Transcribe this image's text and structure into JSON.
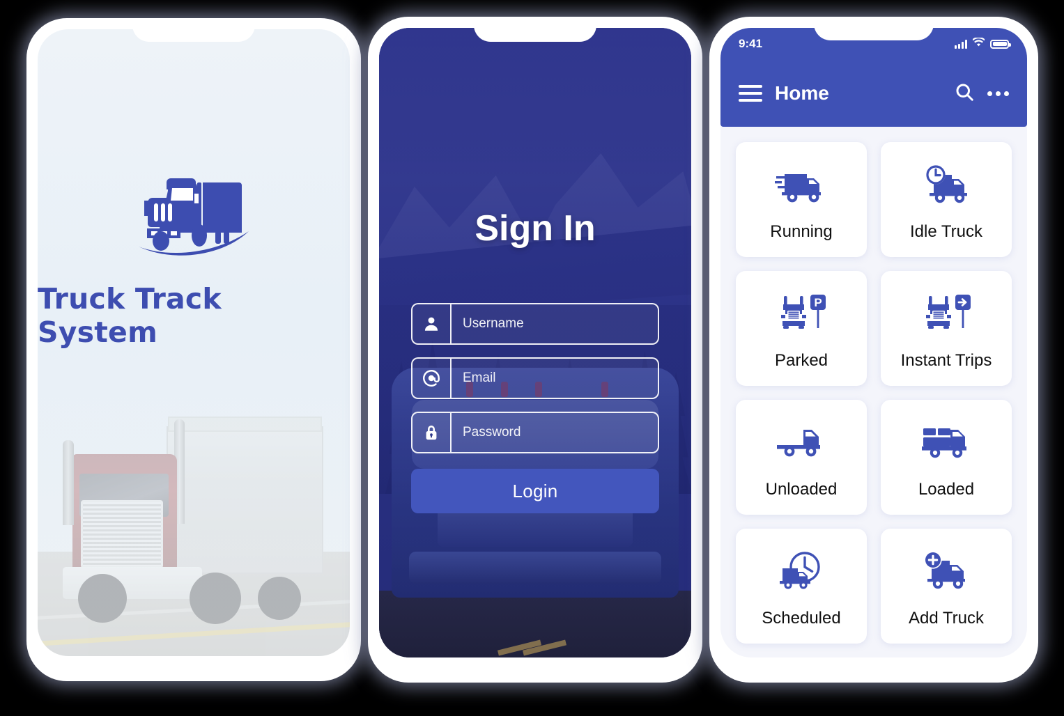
{
  "splash": {
    "app_title": "Truck Track System",
    "logo_icon": "truck-logo-icon",
    "background_photo": "red-semi-truck-on-highway-photo"
  },
  "signin": {
    "title": "Sign In",
    "background_photo": "mountain-forest-highway-truck-photo",
    "fields": [
      {
        "name": "username",
        "icon": "user-icon",
        "placeholder": "Username",
        "value": ""
      },
      {
        "name": "email",
        "icon": "at-sign-icon",
        "placeholder": "Email",
        "value": ""
      },
      {
        "name": "password",
        "icon": "lock-icon",
        "placeholder": "Password",
        "value": ""
      }
    ],
    "login_label": "Login",
    "accent_color": "#4356bd"
  },
  "home": {
    "status_bar": {
      "time": "9:41",
      "signal_icon": "cellular-signal-icon",
      "wifi_icon": "wifi-icon",
      "battery_icon": "battery-full-icon"
    },
    "appbar": {
      "menu_icon": "hamburger-menu-icon",
      "title": "Home",
      "search_icon": "search-icon",
      "more_icon": "more-options-icon",
      "background_color": "#3f51b5"
    },
    "tiles": [
      {
        "label": "Running",
        "icon": "truck-moving-icon"
      },
      {
        "label": "Idle Truck",
        "icon": "truck-clock-icon"
      },
      {
        "label": "Parked",
        "icon": "truck-parking-sign-icon"
      },
      {
        "label": "Instant Trips",
        "icon": "truck-arrow-sign-icon"
      },
      {
        "label": "Unloaded",
        "icon": "truck-empty-bed-icon"
      },
      {
        "label": "Loaded",
        "icon": "truck-with-boxes-icon"
      },
      {
        "label": "Scheduled",
        "icon": "truck-schedule-clock-icon"
      },
      {
        "label": "Add Truck",
        "icon": "truck-plus-icon"
      }
    ],
    "tile_icon_color": "#3f51b5"
  }
}
